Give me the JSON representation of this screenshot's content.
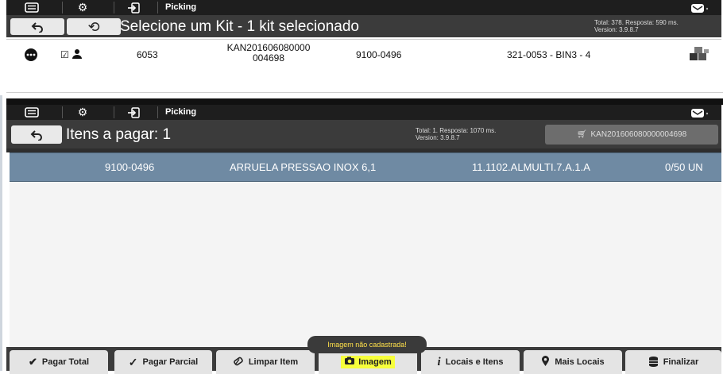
{
  "panel1": {
    "topbar": {
      "title": "Picking"
    },
    "header": {
      "title": "Selecione um Kit - 1 kit selecionado",
      "stats_line1": "Total: 378. Resposta: 590 ms.",
      "stats_line2": "Version: 3.9.8.7"
    },
    "kit_row": {
      "number": "6053",
      "kit_code_line1": "KAN201606080000",
      "kit_code_line2": "004698",
      "part": "9100-0496",
      "location": "321-0053 - BIN3 - 4"
    }
  },
  "panel2": {
    "topbar": {
      "title": "Picking"
    },
    "header": {
      "title": "Itens a pagar: 1",
      "stats_line1": "Total: 1. Resposta: 1070 ms.",
      "stats_line2": "Version: 3.9.8.7",
      "cart_label": "KAN201606080000004698"
    },
    "item_row": {
      "part": "9100-0496",
      "description": "ARRUELA PRESSAO INOX  6,1",
      "location": "11.1102.ALMULTI.7.A.1.A",
      "quantity": "0/50 UN"
    },
    "toast": "Imagem não cadastrada!",
    "buttons": {
      "pagar_total": "Pagar Total",
      "pagar_parcial": "Pagar Parcial",
      "limpar_item": "Limpar Item",
      "imagem": "Imagem",
      "locais_itens": "Locais e Itens",
      "mais_locais": "Mais Locais",
      "finalizar": "Finalizar"
    }
  },
  "colors": {
    "topbar": "#1e1e1e",
    "header": "#3b3b3b",
    "selected_row": "#6f8aa3",
    "toast_text": "#ffe04a"
  }
}
